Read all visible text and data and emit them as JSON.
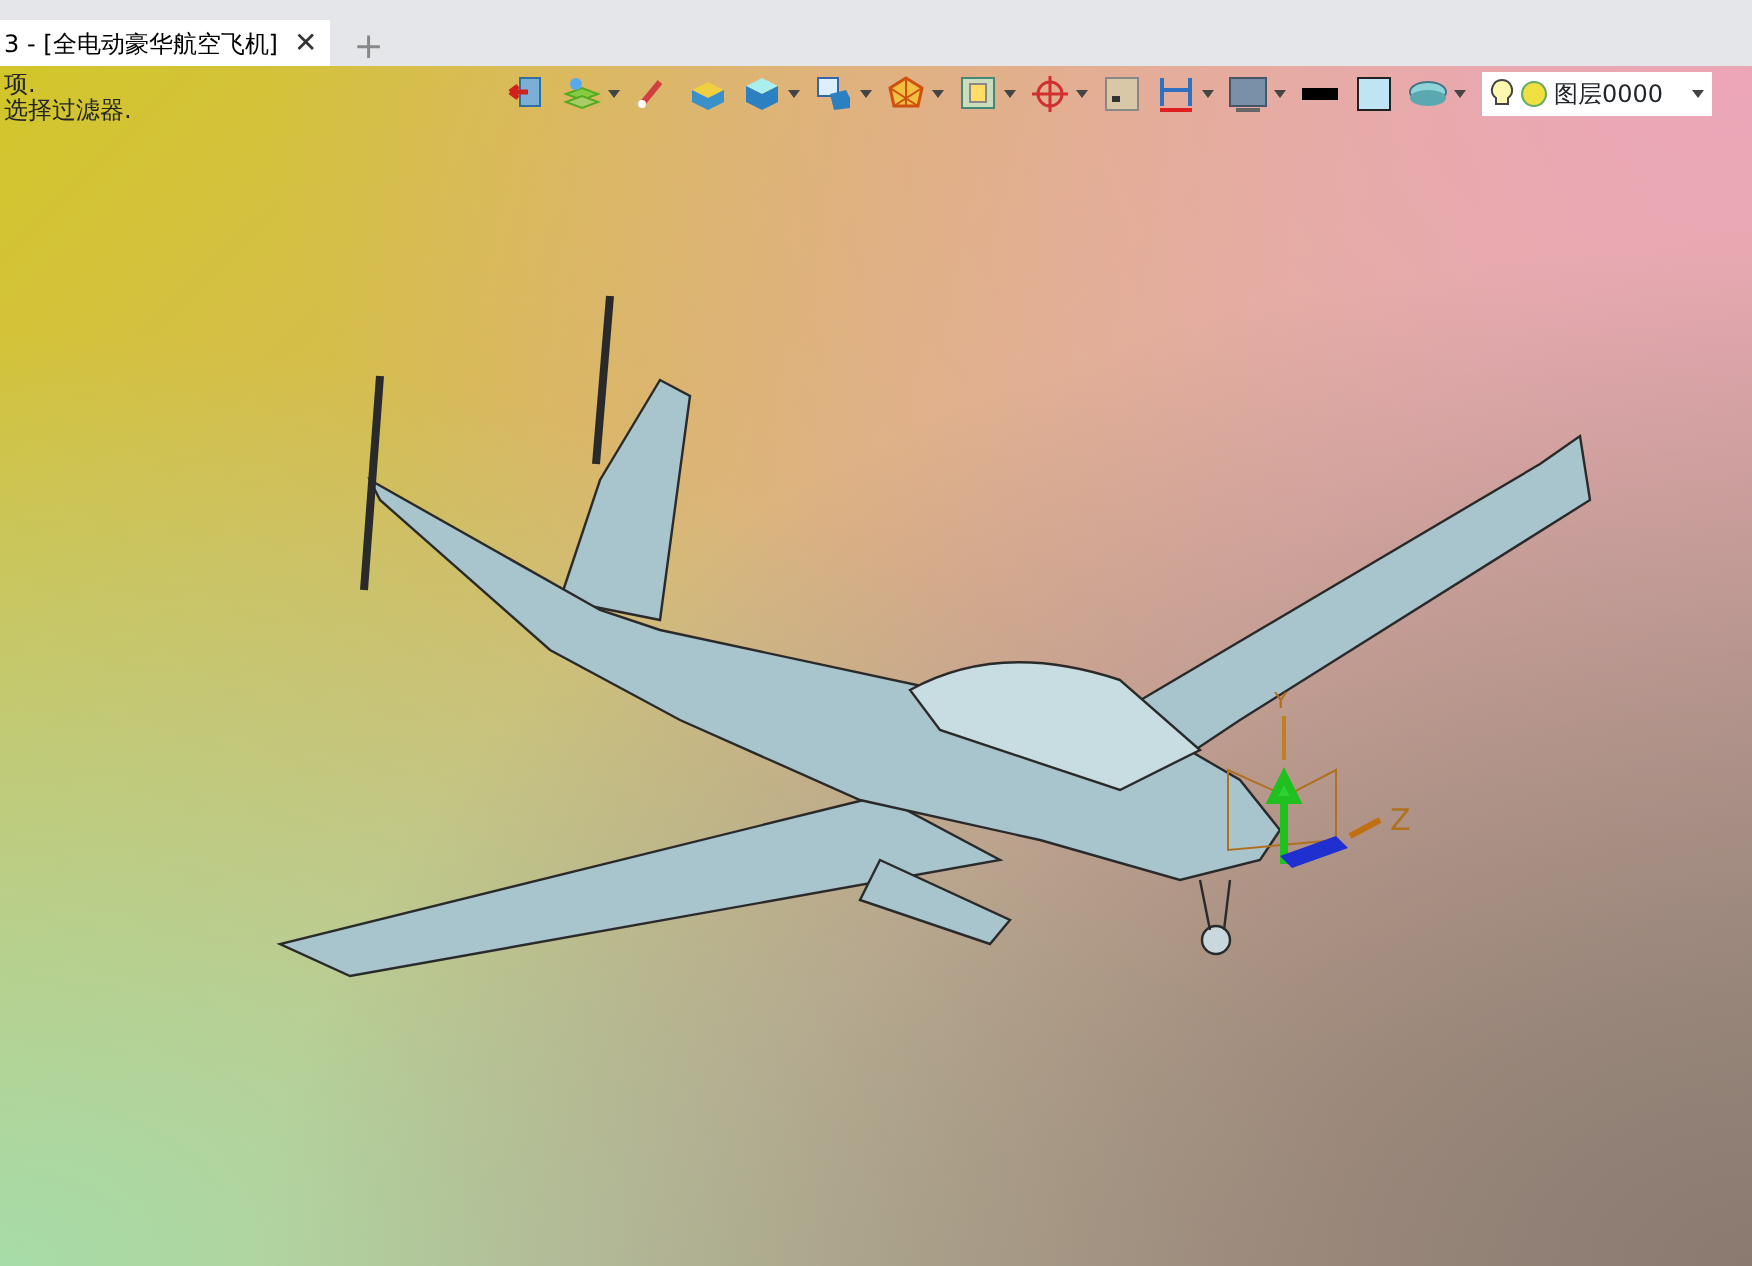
{
  "document_tab": {
    "label": "3 - [全电动豪华航空飞机]",
    "close": "✕",
    "selected": true
  },
  "new_tab": "+",
  "messages": [
    "项.",
    "选择过滤器."
  ],
  "view_toolbar": [
    {
      "kind": "exit",
      "dropdown": false
    },
    {
      "kind": "layers",
      "dropdown": true
    },
    {
      "kind": "brush",
      "dropdown": false
    },
    {
      "kind": "box",
      "dropdown": false
    },
    {
      "kind": "cube",
      "dropdown": true
    },
    {
      "kind": "screen-cube",
      "dropdown": true
    },
    {
      "kind": "polygon",
      "dropdown": true
    },
    {
      "kind": "frame",
      "dropdown": true
    },
    {
      "kind": "crosshair",
      "dropdown": true
    },
    {
      "kind": "small-square",
      "dropdown": false
    },
    {
      "kind": "dimension",
      "dropdown": true
    },
    {
      "kind": "monitor",
      "dropdown": true
    },
    {
      "kind": "line",
      "dropdown": false
    },
    {
      "kind": "swatch",
      "dropdown": false
    },
    {
      "kind": "disc",
      "dropdown": true
    }
  ],
  "layer_select": {
    "value": "图层0000"
  },
  "axis_labels": [
    "Y",
    "Z"
  ]
}
